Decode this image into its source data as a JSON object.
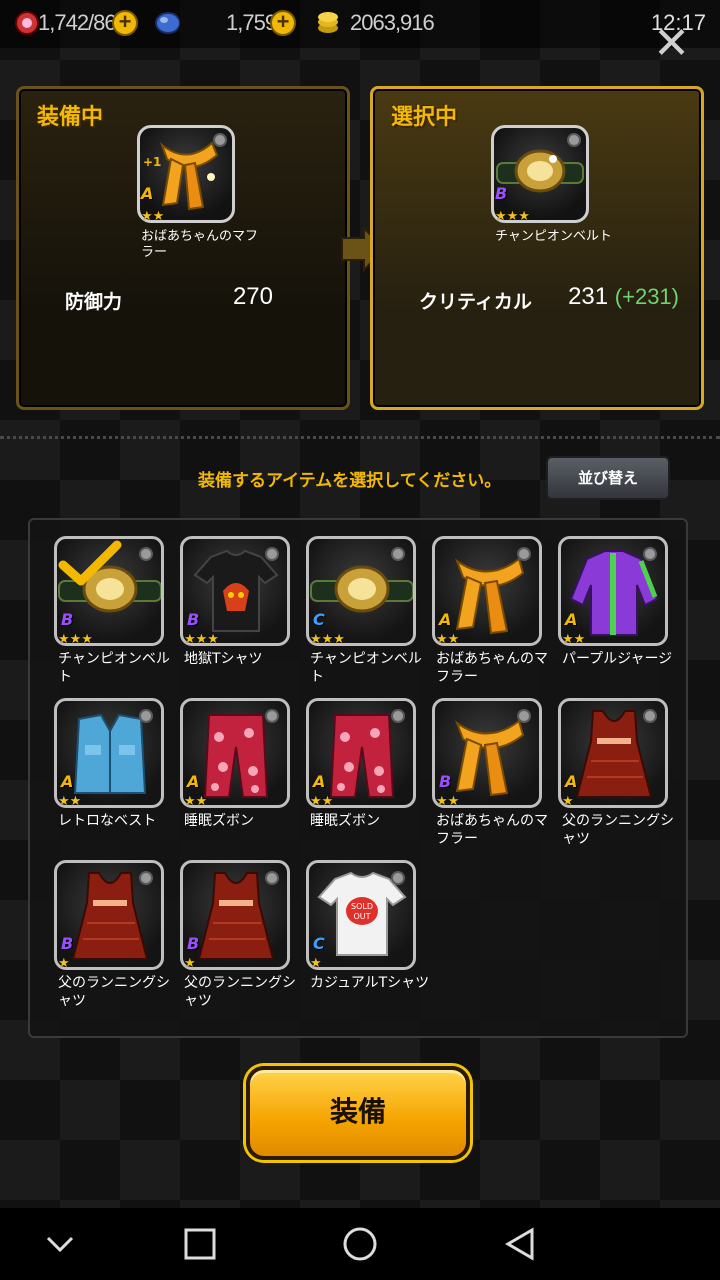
{
  "status_bar": {
    "stamina": "1,742/86",
    "gems": "1,759",
    "coins": "2063,916",
    "time": "12:17"
  },
  "equipped_panel": {
    "title": "装備中",
    "item_name": "おばあちゃんのマフラー",
    "grade": "A",
    "stars": 2,
    "stat_label": "防御力",
    "stat_value": "270",
    "enhance_badge": "+1"
  },
  "selected_panel": {
    "title": "選択中",
    "item_name": "チャンピオンベルト",
    "grade": "B",
    "stars": 3,
    "stat_label": "クリティカル",
    "stat_value": "231",
    "stat_diff": "(+231)"
  },
  "instruction": "装備するアイテムを選択してください。",
  "sort_button": "並び替え",
  "items": [
    {
      "name": "チャンピオンベルト",
      "grade": "B",
      "stars": "★★★",
      "icon": "belt-icon",
      "selected": true
    },
    {
      "name": "地獄Tシャツ",
      "grade": "B",
      "stars": "★★★",
      "icon": "black-shirt-icon"
    },
    {
      "name": "チャンピオンベルト",
      "grade": "C",
      "stars": "★★★",
      "icon": "belt-icon"
    },
    {
      "name": "おばあちゃんのマフラー",
      "grade": "A",
      "stars": "★★",
      "icon": "scarf-icon"
    },
    {
      "name": "パープルジャージ",
      "grade": "A",
      "stars": "★★",
      "icon": "purple-jacket-icon"
    },
    {
      "name": "レトロなベスト",
      "grade": "A",
      "stars": "★★",
      "icon": "denim-vest-icon"
    },
    {
      "name": "睡眠ズボン",
      "grade": "A",
      "stars": "★★",
      "icon": "pajama-pants-icon"
    },
    {
      "name": "睡眠ズボン",
      "grade": "A",
      "stars": "★★",
      "icon": "pajama-pants-icon"
    },
    {
      "name": "おばあちゃんのマフラー",
      "grade": "B",
      "stars": "★★",
      "icon": "scarf-icon"
    },
    {
      "name": "父のランニングシャツ",
      "grade": "A",
      "stars": "★",
      "icon": "tank-top-icon"
    },
    {
      "name": "父のランニングシャツ",
      "grade": "B",
      "stars": "★",
      "icon": "tank-top-icon"
    },
    {
      "name": "父のランニングシャツ",
      "grade": "B",
      "stars": "★",
      "icon": "tank-top-icon"
    },
    {
      "name": "カジュアルTシャツ",
      "grade": "C",
      "stars": "★",
      "icon": "white-tshirt-icon"
    }
  ],
  "equip_button": "装備",
  "colors": {
    "accent": "#f2b806",
    "grade_A": "#f2b806",
    "grade_B": "#9b4dff",
    "grade_C": "#3aa0ff",
    "diff_green": "#6fd36f"
  }
}
